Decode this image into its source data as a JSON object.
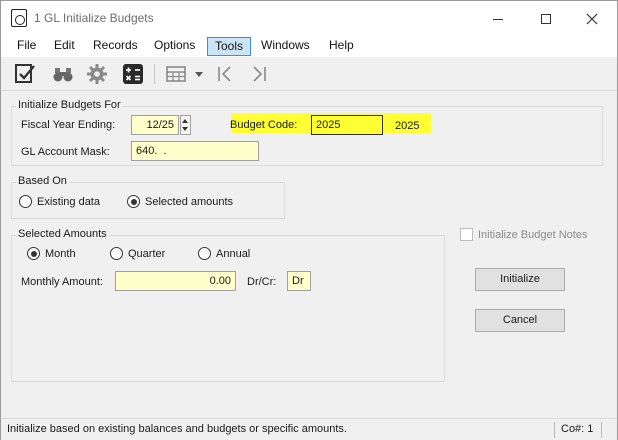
{
  "window": {
    "title": "1 GL Initialize Budgets",
    "controls": {
      "minimize": "minimize-icon",
      "maximize": "maximize-icon",
      "close": "close-icon"
    }
  },
  "menu": {
    "items": [
      {
        "label": "File",
        "active": false
      },
      {
        "label": "Edit",
        "active": false
      },
      {
        "label": "Records",
        "active": false
      },
      {
        "label": "Options",
        "active": false
      },
      {
        "label": "Tools",
        "active": true
      },
      {
        "label": "Windows",
        "active": false
      },
      {
        "label": "Help",
        "active": false
      }
    ]
  },
  "toolbar": {
    "icons": [
      "checklist-icon",
      "binoculars-icon",
      "gear-icon",
      "calculator-icon",
      "table-icon",
      "dropdown-arrow-icon",
      "first-record-icon",
      "last-record-icon"
    ]
  },
  "initialize_group": {
    "legend": "Initialize Budgets For",
    "fiscal_year_label": "Fiscal Year Ending:",
    "fiscal_year_value": "12/25",
    "budget_code_label": "Budget Code:",
    "budget_code_value": "2025",
    "budget_code_description": "2025",
    "account_mask_label": "GL Account Mask:",
    "account_mask_value": "640.  ."
  },
  "based_on_group": {
    "legend": "Based On",
    "options": [
      {
        "label": "Existing data",
        "checked": false
      },
      {
        "label": "Selected amounts",
        "checked": true
      }
    ]
  },
  "selected_amounts_group": {
    "legend": "Selected Amounts",
    "periods": [
      {
        "label": "Month",
        "checked": true
      },
      {
        "label": "Quarter",
        "checked": false
      },
      {
        "label": "Annual",
        "checked": false
      }
    ],
    "amount_label": "Monthly Amount:",
    "amount_value": "0.00",
    "drcr_label": "Dr/Cr:",
    "drcr_value": "Dr"
  },
  "options": {
    "notes_label": "Initialize Budget Notes",
    "notes_checked": false
  },
  "actions": {
    "initialize_label": "Initialize",
    "cancel_label": "Cancel"
  },
  "status": {
    "message": "Initialize based on existing balances and budgets or specific amounts.",
    "company": "Co#: 1"
  },
  "colors": {
    "field_background": "#ffffcc",
    "highlight": "#ffff33",
    "active_menu": "#cce4f7"
  }
}
